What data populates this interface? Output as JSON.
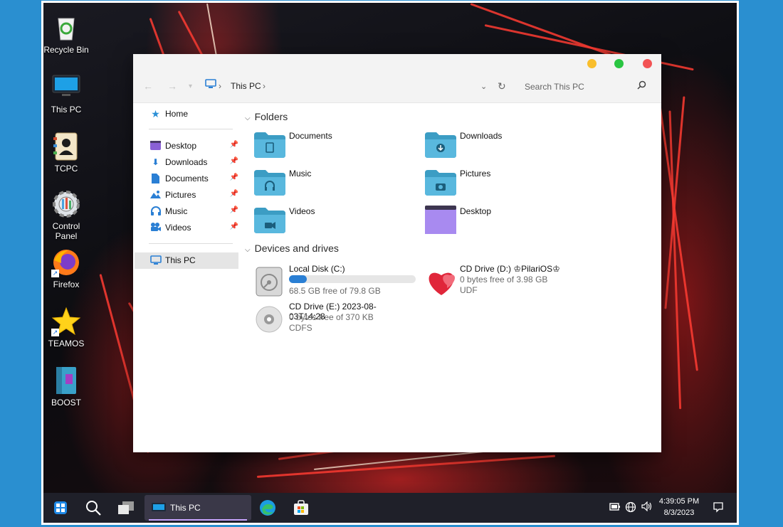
{
  "desktop": {
    "icons": [
      {
        "label": "Recycle Bin"
      },
      {
        "label": "This PC"
      },
      {
        "label": "TCPC"
      },
      {
        "label": "Control Panel"
      },
      {
        "label": "Firefox"
      },
      {
        "label": "TEAMOS"
      },
      {
        "label": "BOOST"
      }
    ]
  },
  "window": {
    "controls_colors": {
      "minimize": "#f9be2c",
      "maximize": "#29c541",
      "close": "#f25354"
    },
    "breadcrumb": {
      "location": "This PC",
      "separator": "›"
    },
    "search_placeholder": "Search This PC",
    "sidebar": {
      "home": "Home",
      "quick_access": [
        {
          "label": "Desktop"
        },
        {
          "label": "Downloads"
        },
        {
          "label": "Documents"
        },
        {
          "label": "Pictures"
        },
        {
          "label": "Music"
        },
        {
          "label": "Videos"
        }
      ],
      "this_pc": "This PC"
    },
    "folders_section": {
      "title": "Folders",
      "items": [
        {
          "name": "Documents"
        },
        {
          "name": "Downloads"
        },
        {
          "name": "Music"
        },
        {
          "name": "Pictures"
        },
        {
          "name": "Videos"
        },
        {
          "name": "Desktop"
        }
      ]
    },
    "drives_section": {
      "title": "Devices and drives",
      "drives": [
        {
          "name": "Local Disk (C:)",
          "free_text": "68.5 GB free of 79.8 GB",
          "used_fraction": 0.14
        },
        {
          "name": "CD Drive (D:) ♔PilariOS♔",
          "free_text": "0 bytes free of 3.98 GB",
          "fs": "UDF"
        },
        {
          "name": "CD Drive (E:) 2023-08-03T14:28",
          "free_text": "0 bytes free of 370 KB",
          "fs": "CDFS"
        }
      ]
    }
  },
  "taskbar": {
    "active_app": "This PC",
    "time": "4:39:05 PM",
    "date": "8/3/2023",
    "accent": "#c7a5ff"
  }
}
